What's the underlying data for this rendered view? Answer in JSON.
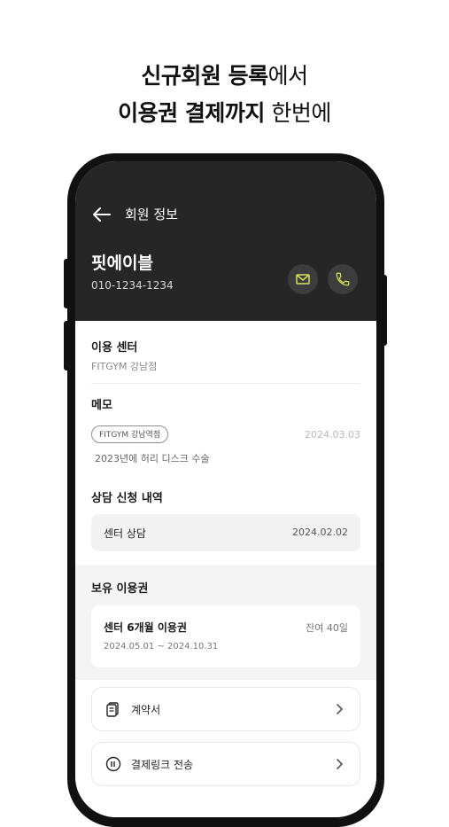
{
  "headline": {
    "line1_bold": "신규회원 등록",
    "line1_light": "에서",
    "line2_bold": "이용권 결제까지",
    "line2_light": " 한번에"
  },
  "screen": {
    "nav": {
      "back_icon": "arrow-left-icon",
      "title": "회원 정보"
    },
    "member": {
      "name": "핏에이블",
      "phone": "010-1234-1234",
      "actions": [
        {
          "icon": "mail-icon",
          "color": "#d8e05a"
        },
        {
          "icon": "phone-icon",
          "color": "#d8e05a"
        }
      ]
    },
    "center": {
      "label": "이용 센터",
      "value": "FITGYM 강남점"
    },
    "memo": {
      "label": "메모",
      "tag": "FITGYM 강남역점",
      "date": "2024.03.03",
      "text": "2023년에 허리 디스크 수술"
    },
    "consult": {
      "label": "상담 신청 내역",
      "item_title": "센터 상담",
      "item_date": "2024.02.02"
    },
    "passes": {
      "label": "보유 이용권",
      "items": [
        {
          "title": "센터 6개월 이용권",
          "period": "2024.05.01 ~ 2024.10.31",
          "remaining": "잔여 40일"
        }
      ]
    },
    "menu": [
      {
        "icon": "document-icon",
        "label": "계약서",
        "chevron": "chevron-right-icon"
      },
      {
        "icon": "payment-link-icon",
        "label": "결제링크 전송",
        "chevron": "chevron-right-icon"
      }
    ]
  },
  "colors": {
    "header_bg": "#262626",
    "accent": "#d8e05a",
    "page_bg": "#f4f4f4"
  }
}
